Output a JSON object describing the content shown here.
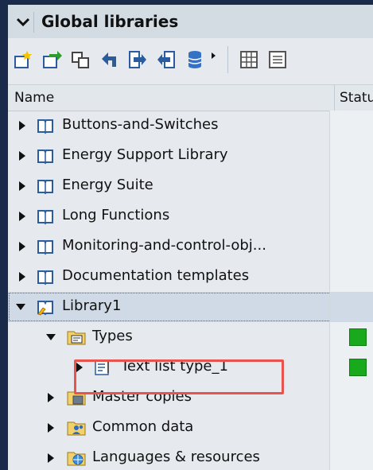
{
  "panel": {
    "title": "Global libraries"
  },
  "columns": {
    "name": "Name",
    "status": "Statu"
  },
  "toolbar": {
    "buttons": [
      {
        "icon": "new-library-icon"
      },
      {
        "icon": "open-library-icon"
      },
      {
        "icon": "copy-icon"
      },
      {
        "icon": "up-icon"
      },
      {
        "icon": "export-icon"
      },
      {
        "icon": "import-icon"
      },
      {
        "icon": "database-icon"
      },
      {
        "icon": "more-icon"
      },
      {
        "icon": "grid-icon"
      },
      {
        "icon": "list-icon"
      }
    ]
  },
  "tree": {
    "items": [
      {
        "label": "Buttons-and-Switches"
      },
      {
        "label": "Energy Support Library"
      },
      {
        "label": "Energy Suite"
      },
      {
        "label": "Long Functions"
      },
      {
        "label": "Monitoring-and-control-obj..."
      },
      {
        "label": "Documentation templates"
      },
      {
        "label": "Library1"
      },
      {
        "label": "Types"
      },
      {
        "label": "Text list type_1"
      },
      {
        "label": "Master copies"
      },
      {
        "label": "Common data"
      },
      {
        "label": "Languages & resources"
      }
    ]
  },
  "colors": {
    "status_ok": "#19a91c",
    "highlight": "#e8534e",
    "selected": "#cfdae6"
  }
}
